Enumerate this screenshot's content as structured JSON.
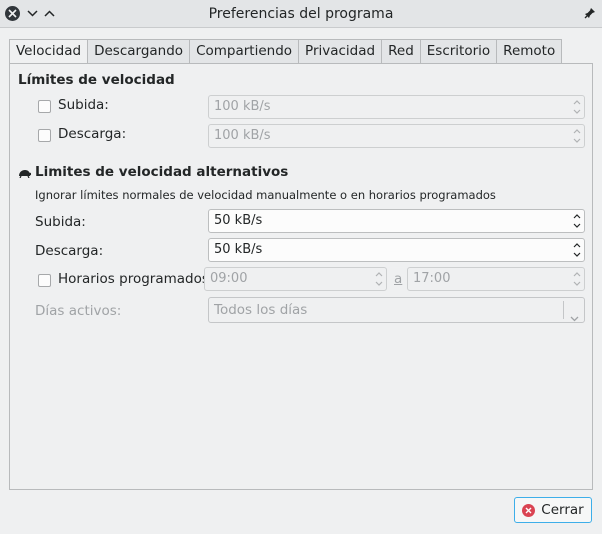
{
  "window": {
    "title": "Preferencias del programa"
  },
  "tabs": [
    {
      "label": "Velocidad",
      "active": true
    },
    {
      "label": "Descargando"
    },
    {
      "label": "Compartiendo"
    },
    {
      "label": "Privacidad"
    },
    {
      "label": "Red"
    },
    {
      "label": "Escritorio"
    },
    {
      "label": "Remoto"
    }
  ],
  "speed_limits": {
    "title": "Límites de velocidad",
    "upload_label": "Subida:",
    "upload_value": "100 kB/s",
    "download_label": "Descarga:",
    "download_value": "100 kB/s"
  },
  "alt_limits": {
    "title": "Limites de velocidad alternativos",
    "description": "Ignorar límites normales de velocidad manualmente o en horarios programados",
    "upload_label": "Subida:",
    "upload_value": "50 kB/s",
    "download_label": "Descarga:",
    "download_value": "50 kB/s",
    "scheduled_label": "Horarios programados:",
    "start_time": "09:00",
    "to_label": "a",
    "end_time": "17:00",
    "days_label": "Días activos:",
    "days_value": "Todos los días"
  },
  "buttons": {
    "close_label": "Cerrar"
  }
}
